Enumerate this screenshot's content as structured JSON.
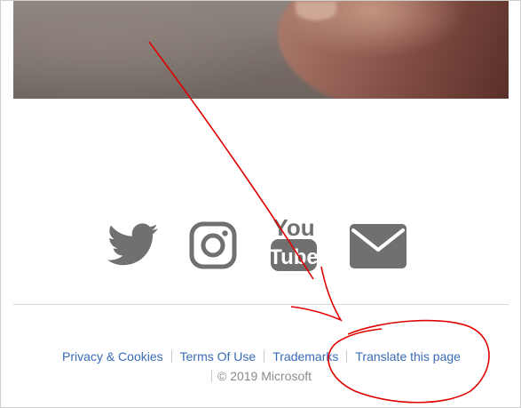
{
  "footer": {
    "links": [
      {
        "label": "Privacy & Cookies"
      },
      {
        "label": "Terms Of Use"
      },
      {
        "label": "Trademarks"
      },
      {
        "label": "Translate this page"
      }
    ],
    "copyright": "© 2019 Microsoft"
  },
  "social": {
    "icons": [
      "twitter-icon",
      "instagram-icon",
      "youtube-icon",
      "mail-icon"
    ],
    "youtube_text_top": "You",
    "youtube_text_bottom": "Tube"
  },
  "colors": {
    "link": "#3a6bb5",
    "icon": "#707070",
    "annotation": "#e00000",
    "muted_text": "#8a8a8a"
  }
}
